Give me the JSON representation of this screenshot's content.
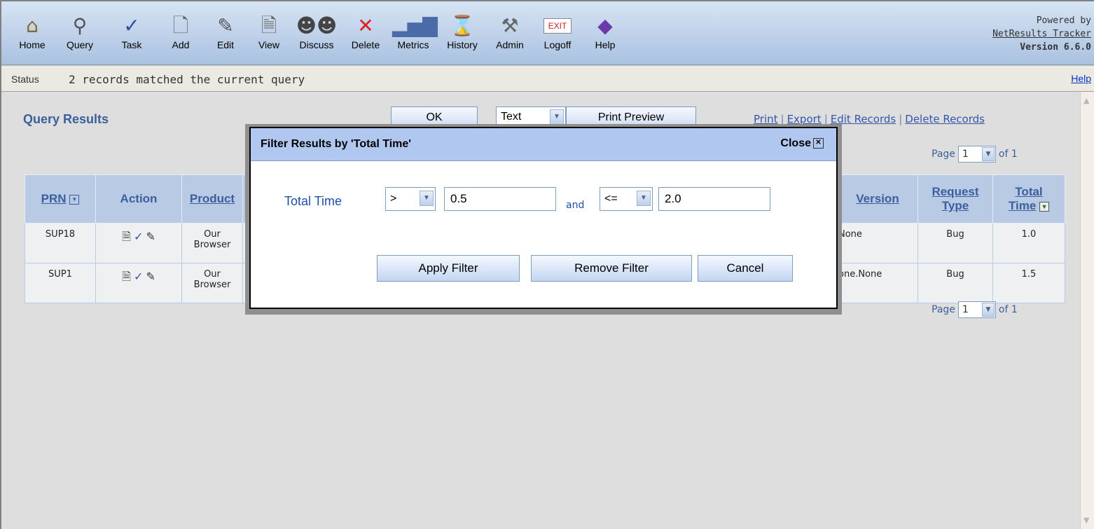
{
  "toolbar": {
    "items": [
      {
        "label": "Home",
        "icon": "🏠"
      },
      {
        "label": "Query",
        "icon": "🔍"
      },
      {
        "label": "Task",
        "icon": "✔"
      },
      {
        "label": "Add",
        "icon": "🗋"
      },
      {
        "label": "Edit",
        "icon": "✎"
      },
      {
        "label": "View",
        "icon": "🗎"
      },
      {
        "label": "Discuss",
        "icon": "👥"
      },
      {
        "label": "Delete",
        "icon": "✖"
      },
      {
        "label": "Metrics",
        "icon": "📊"
      },
      {
        "label": "History",
        "icon": "⌛"
      },
      {
        "label": "Admin",
        "icon": "🔧"
      },
      {
        "label": "Logoff",
        "icon": "EXIT"
      },
      {
        "label": "Help",
        "icon": "📘"
      }
    ],
    "powered_by": "Powered by",
    "product_link": "NetResults Tracker",
    "version": "Version 6.6.0"
  },
  "status": {
    "label": "Status",
    "text": "2 records matched the current query",
    "help": "Help"
  },
  "page": {
    "title": "Query Results",
    "ok_button": "OK",
    "format_select": "Text",
    "print_preview_button": "Print Preview",
    "links": {
      "print": "Print",
      "export": "Export",
      "edit_records": "Edit Records",
      "delete_records": "Delete Records"
    },
    "pager": {
      "page_label": "Page",
      "page_value": "1",
      "of_label": "of 1"
    }
  },
  "table": {
    "headers": {
      "prn": "PRN",
      "action": "Action",
      "product": "Product",
      "version": "Version",
      "request_type_1": "Request",
      "request_type_2": "Type",
      "total_time_1": "Total",
      "total_time_2": "Time"
    },
    "rows": [
      {
        "prn": "SUP18",
        "product_1": "Our",
        "product_2": "Browser",
        "version": "None",
        "request_type": "Bug",
        "total_time": "1.0"
      },
      {
        "prn": "SUP1",
        "product_1": "Our",
        "product_2": "Browser",
        "version": "one.None",
        "request_type": "Bug",
        "total_time": "1.5"
      }
    ]
  },
  "filter_dialog": {
    "title": "Filter Results by 'Total Time'",
    "close": "Close",
    "field_label": "Total Time",
    "operator_1": ">",
    "value_1": "0.5",
    "and_label": "and",
    "operator_2": "<=",
    "value_2": "2.0",
    "apply_button": "Apply Filter",
    "remove_button": "Remove Filter",
    "cancel_button": "Cancel"
  }
}
